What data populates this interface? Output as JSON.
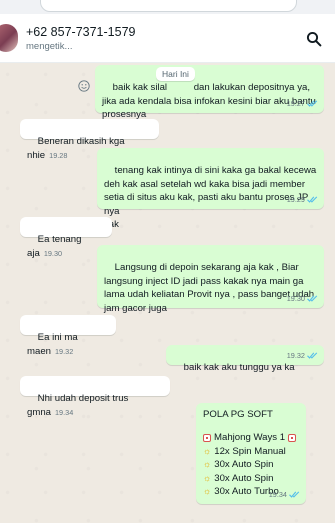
{
  "header": {
    "contact_name": "+62 857-7371-1579",
    "status": "mengetik..."
  },
  "date_chip": "Hari Ini",
  "messages": [
    {
      "dir": "out",
      "text": "baik kak silal          dan lakukan depositnya ya,\njika ada kendala bisa infokan kesini biar aku bantu\nprosesnya",
      "time": "19.27"
    },
    {
      "dir": "in",
      "text": "Beneran dikasih kga nhie",
      "time": "19.28"
    },
    {
      "dir": "out",
      "text": "tenang kak intinya di sini kaka ga bakal kecewa\ndeh kak asal setelah wd kaka bisa jadi member\nsetia di situs aku kak, pasti aku bantu proses JP nya\nkak",
      "time": "19.29"
    },
    {
      "dir": "in",
      "text": "Ea tenang aja",
      "time": "19.30"
    },
    {
      "dir": "out",
      "text": "Langsung di depoin sekarang aja kak , Biar\nlangsung inject ID jadi pass kakak nya main ga\nlama udah keliatan Provit nya , pass banget udah\njam gacor juga",
      "time": "19.30"
    },
    {
      "dir": "in",
      "text": "Ea ini ma maen",
      "time": "19.32"
    },
    {
      "dir": "out",
      "text": "baik kak aku tunggu ya ka",
      "time": "19.32"
    },
    {
      "dir": "in",
      "text": "Nhi udah deposit trus gmna",
      "time": "19.34"
    },
    {
      "dir": "out",
      "title": "POLA PG SOFT",
      "game": "Mahjong Ways 1",
      "lines": [
        "12x Spin Manual",
        "30x Auto Spin",
        "30x Auto Spin",
        "30x Auto Turbo"
      ],
      "time": "19.34"
    }
  ],
  "colors": {
    "outgoing_bubble": "#d9fdd3",
    "incoming_bubble": "#ffffff",
    "chat_background": "#efeae2",
    "read_ticks": "#53bdeb"
  },
  "icons": {
    "search": "search-icon",
    "emoji": "emoji-icon",
    "read_receipt": "double-check-icon"
  }
}
